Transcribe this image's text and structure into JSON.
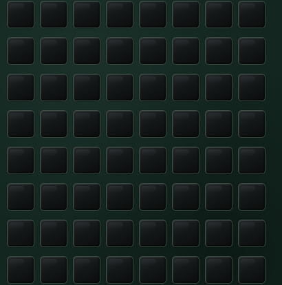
{
  "board": {
    "rows": 8,
    "columns": 8,
    "tile_state": "empty",
    "colors": {
      "background": "#132620",
      "tile_fill": "#141718",
      "tile_border": "#3c4c43"
    }
  }
}
